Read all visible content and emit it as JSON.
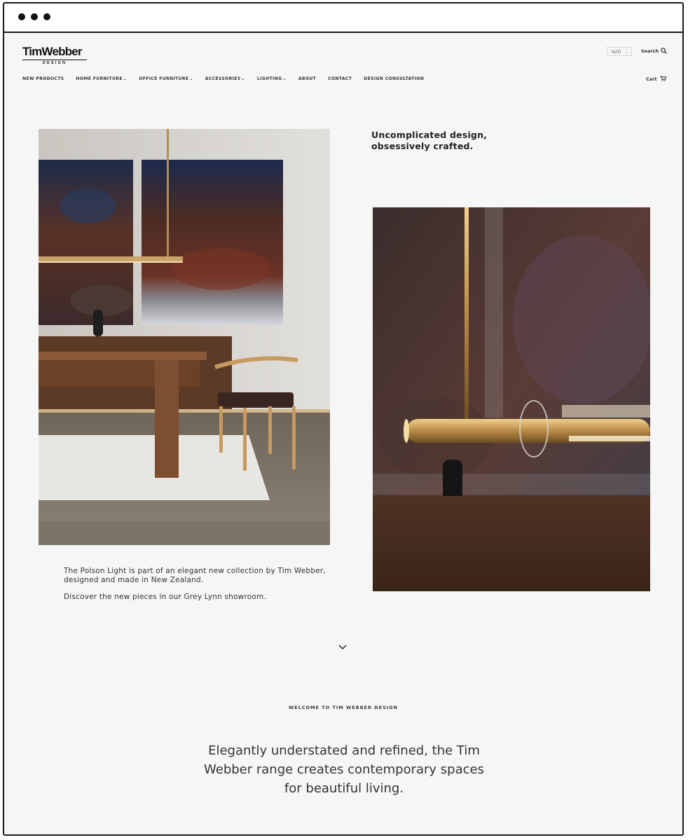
{
  "brand": {
    "name": "TimWebber",
    "sub": "DESIGN"
  },
  "header": {
    "currency": "NZD",
    "search_label": "Search",
    "cart_label": "Cart"
  },
  "nav": {
    "items": [
      {
        "label": "NEW PRODUCTS",
        "dropdown": false
      },
      {
        "label": "HOME FURNITURE",
        "dropdown": true
      },
      {
        "label": "OFFICE FURNITURE",
        "dropdown": true
      },
      {
        "label": "ACCESSORIES",
        "dropdown": true
      },
      {
        "label": "LIGHTING",
        "dropdown": true
      },
      {
        "label": "ABOUT",
        "dropdown": false
      },
      {
        "label": "CONTACT",
        "dropdown": false
      },
      {
        "label": "DESIGN CONSULTATION",
        "dropdown": false
      }
    ]
  },
  "hero": {
    "tagline_line1": "Uncomplicated design,",
    "tagline_line2": "obsessively crafted.",
    "copy_p1": "The Polson Light is part of an elegant new collection by Tim Webber, designed and made in New Zealand.",
    "copy_p2": "Discover the new pieces in our Grey Lynn showroom."
  },
  "welcome": {
    "heading": "WELCOME TO TIM WEBBER DESIGN",
    "intro": "Elegantly understated and refined, the Tim Webber range creates contemporary spaces for beautiful living."
  },
  "icons": {
    "search": "magnifier-icon",
    "cart": "cart-icon",
    "scroll": "chevron-down-icon"
  },
  "colors": {
    "page_bg": "#f6f6f6",
    "text": "#2b2b2b",
    "brass": "#c8a060",
    "wood": "#7a4f32"
  }
}
